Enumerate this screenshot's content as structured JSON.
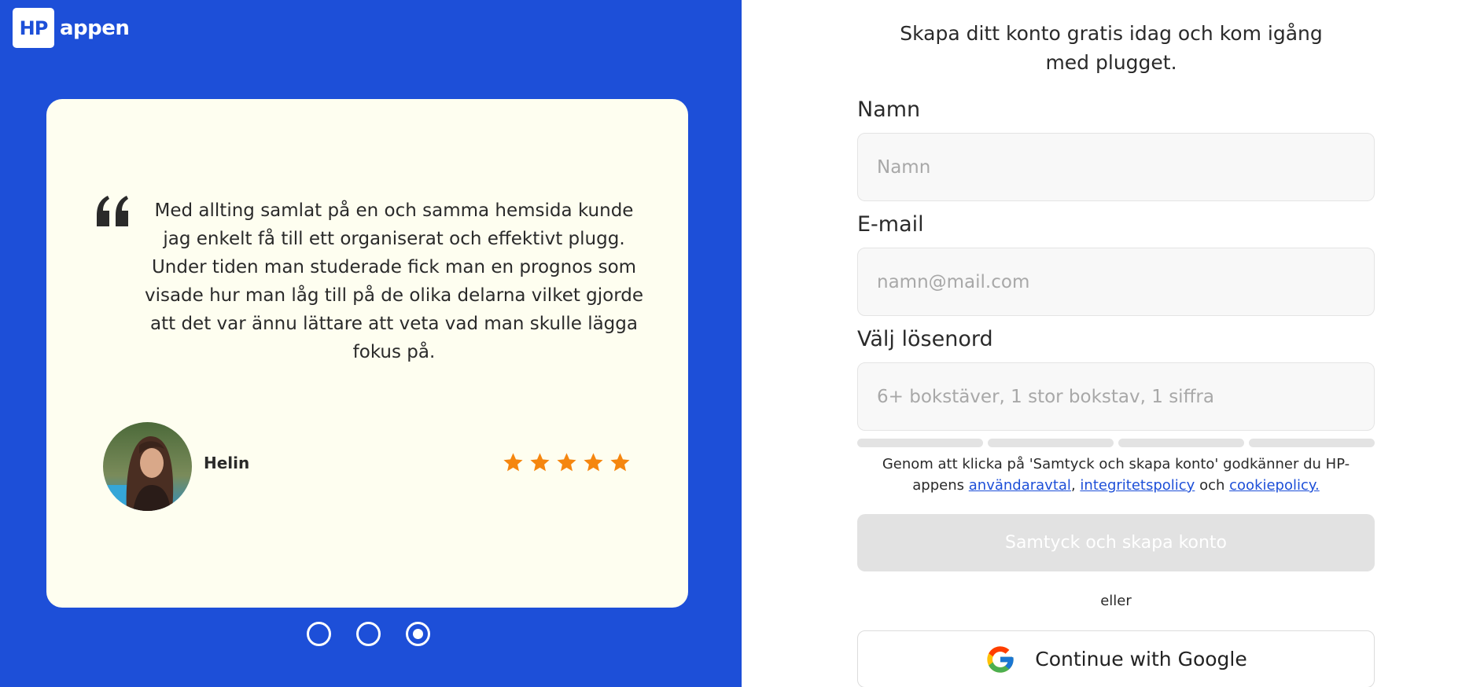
{
  "brand": {
    "logo_mark": "HP",
    "logo_text": "appen"
  },
  "testimonial": {
    "quote": "Med allting samlat på en och samma hemsida kunde jag enkelt få till ett organiserat och effektivt plugg. Under tiden man studerade fick man en prognos som visade hur man låg till på de olika delarna vilket gjorde att det var ännu lättare att veta vad man skulle lägga fokus på.",
    "author": "Helin",
    "rating": 5,
    "card_color": "#fefef0",
    "star_color": "#f5860f"
  },
  "carousel": {
    "slide_count": 3,
    "active_index": 2
  },
  "signup": {
    "subtitle": "Skapa ditt konto gratis idag och kom igång med plugget.",
    "name_label": "Namn",
    "name_placeholder": "Namn",
    "email_label": "E-mail",
    "email_placeholder": "namn@mail.com",
    "password_label": "Välj lösenord",
    "password_placeholder": "6+ bokstäver, 1 stor bokstav, 1 siffra",
    "terms_prefix": "Genom att klicka på 'Samtyck och skapa konto' godkänner du HP-appens",
    "terms_link_1": "användaravtal",
    "terms_sep": ",",
    "terms_link_2": "integritetspolicy",
    "terms_and": "och",
    "terms_link_3": "cookiepolicy.",
    "submit_label": "Samtyck och skapa konto",
    "or_label": "eller",
    "google_label": "Continue with Google"
  },
  "colors": {
    "brand_blue": "#1d4fd8",
    "disabled_button": "#e2e2e2"
  },
  "icons": {
    "quote": "quote-icon",
    "star": "star-icon",
    "google": "google-icon",
    "avatar": "avatar-photo"
  }
}
